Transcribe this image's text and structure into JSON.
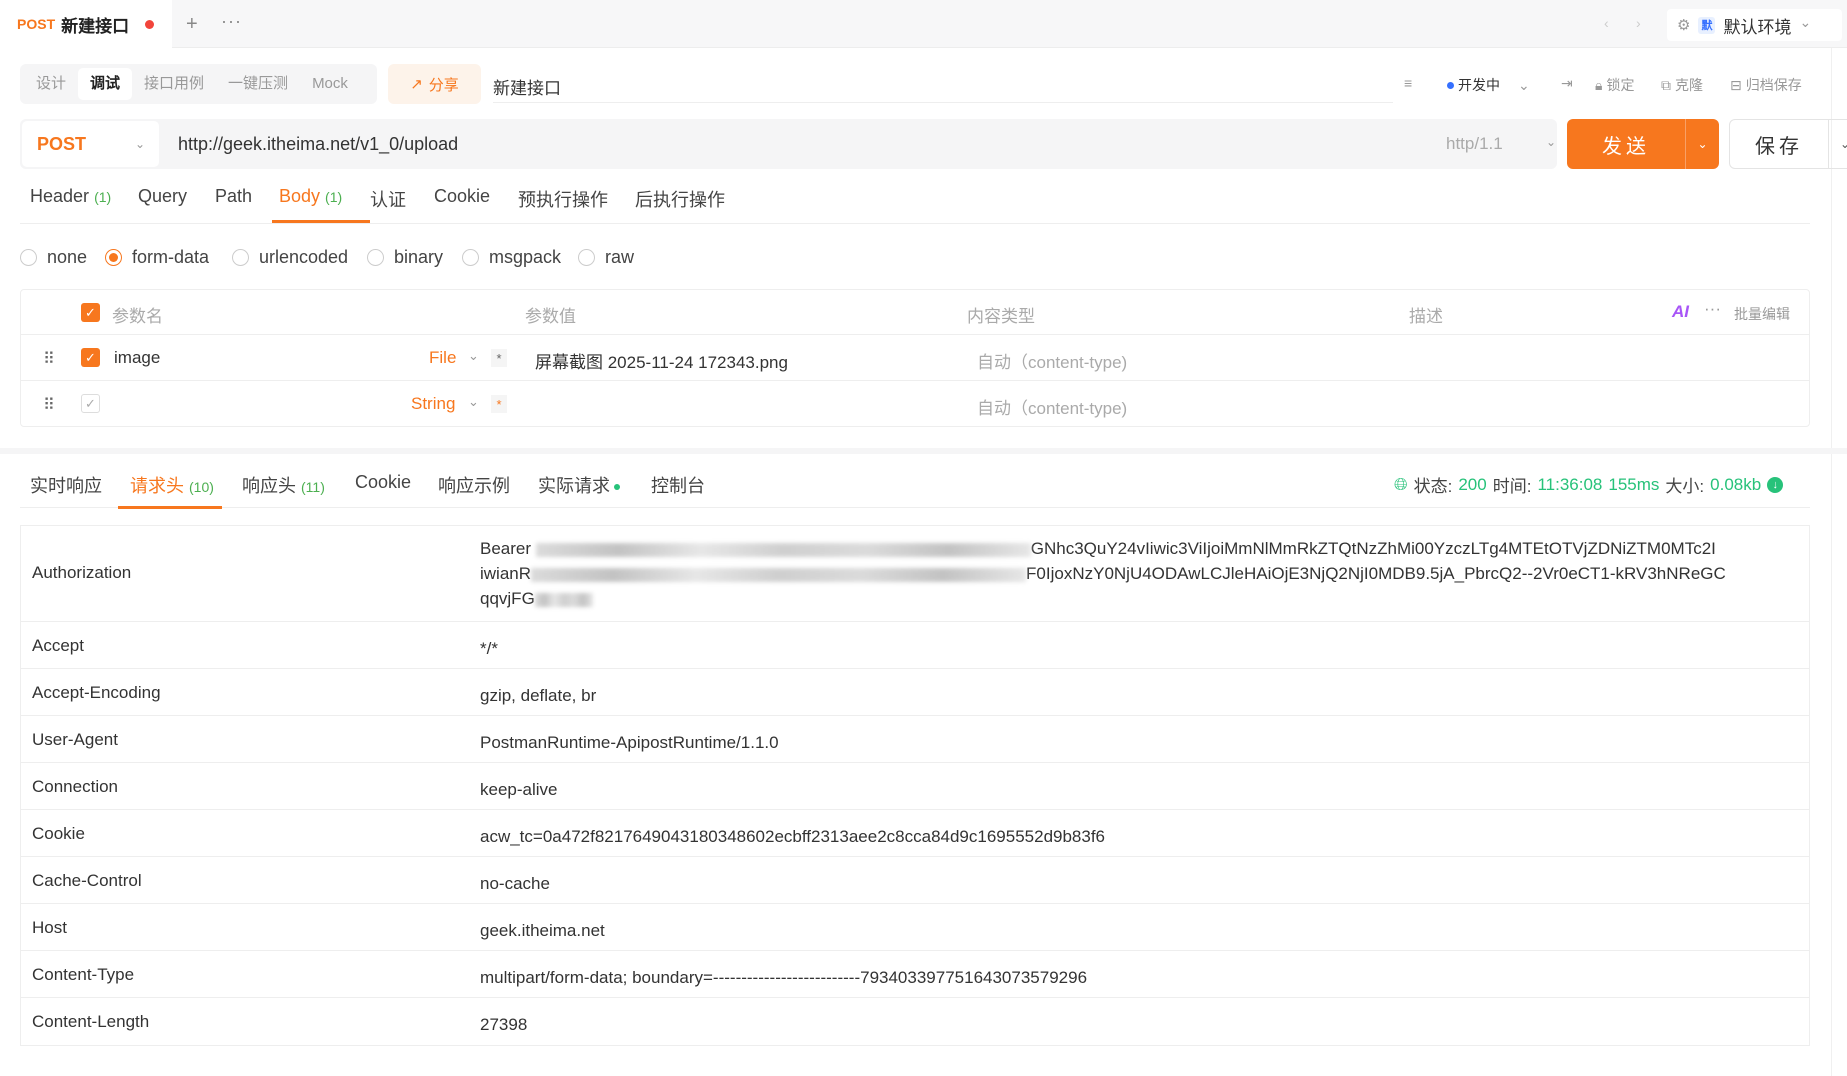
{
  "tab": {
    "method": "POST",
    "title": "新建接口",
    "add": "+",
    "more": "···"
  },
  "nav": {
    "prev": "‹",
    "next": "›"
  },
  "env": {
    "badge": "默",
    "name": "默认环境",
    "chev": "⌄"
  },
  "modes": [
    "设计",
    "调试",
    "接口用例",
    "一键压测",
    "Mock"
  ],
  "share": {
    "label": "分享"
  },
  "api_name": "新建接口",
  "right_actions": {
    "status": "开发中",
    "lock": "锁定",
    "clone": "克隆",
    "archive": "归档保存"
  },
  "url": {
    "method": "POST",
    "value": "http://geek.itheima.net/v1_0/upload",
    "http_version": "http/1.1"
  },
  "buttons": {
    "send": "发送",
    "save": "保存"
  },
  "req_tabs": [
    {
      "label": "Header",
      "count": "(1)"
    },
    {
      "label": "Query",
      "count": ""
    },
    {
      "label": "Path",
      "count": ""
    },
    {
      "label": "Body",
      "count": "(1)"
    },
    {
      "label": "认证",
      "count": ""
    },
    {
      "label": "Cookie",
      "count": ""
    },
    {
      "label": "预执行操作",
      "count": ""
    },
    {
      "label": "后执行操作",
      "count": ""
    }
  ],
  "body_types": [
    "none",
    "form-data",
    "urlencoded",
    "binary",
    "msgpack",
    "raw"
  ],
  "params": {
    "headers": [
      "参数名",
      "参数值",
      "内容类型",
      "描述"
    ],
    "ai": "AI",
    "bulk_edit": "批量编辑",
    "rows": [
      {
        "name": "image",
        "type": "File",
        "value": "屏幕截图 2025-11-24 172343.png",
        "content_type": "自动（content-type)"
      },
      {
        "name": "",
        "type": "String",
        "value": "",
        "content_type": "自动（content-type)"
      }
    ]
  },
  "resp_tabs": [
    {
      "label": "实时响应",
      "count": ""
    },
    {
      "label": "请求头",
      "count": "(10)"
    },
    {
      "label": "响应头",
      "count": "(11)"
    },
    {
      "label": "Cookie",
      "count": ""
    },
    {
      "label": "响应示例",
      "count": ""
    },
    {
      "label": "实际请求",
      "count": ""
    },
    {
      "label": "控制台",
      "count": ""
    }
  ],
  "status": {
    "status_label": "状态:",
    "code": "200",
    "time_label": "时间:",
    "time": "11:36:08",
    "duration": "155ms",
    "size_label": "大小:",
    "size": "0.08kb"
  },
  "req_headers": [
    {
      "key": "Authorization",
      "v1": "Bearer ",
      "v2": "GNhc3QuY24vIiwic3ViIjoiMmNlMmRkZTQtNzZhMi00YzczLTg4MTEtOTVjZDNiZTM0MTc2I",
      "v3": "iwianR",
      "v4": "F0IjoxNzY0NjU4ODAwLCJleHAiOjE3NjQ2NjI0MDB9.5jA_PbrcQ2--2Vr0eCT1-kRV3hNReGC",
      "v5": "qqvjFG"
    },
    {
      "key": "Accept",
      "value": "*/*"
    },
    {
      "key": "Accept-Encoding",
      "value": "gzip, deflate, br"
    },
    {
      "key": "User-Agent",
      "value": "PostmanRuntime-ApipostRuntime/1.1.0"
    },
    {
      "key": "Connection",
      "value": "keep-alive"
    },
    {
      "key": "Cookie",
      "value": "acw_tc=0a472f8217649043180348602ecbff2313aee2c8cca84d9c1695552d9b83f6"
    },
    {
      "key": "Cache-Control",
      "value": "no-cache"
    },
    {
      "key": "Host",
      "value": "geek.itheima.net"
    },
    {
      "key": "Content-Type",
      "value": "multipart/form-data; boundary=--------------------------793403397751643073579296"
    },
    {
      "key": "Content-Length",
      "value": "27398"
    }
  ],
  "colors": {
    "accent": "#f7771e",
    "green": "#27c27a",
    "blue": "#3570ff"
  }
}
